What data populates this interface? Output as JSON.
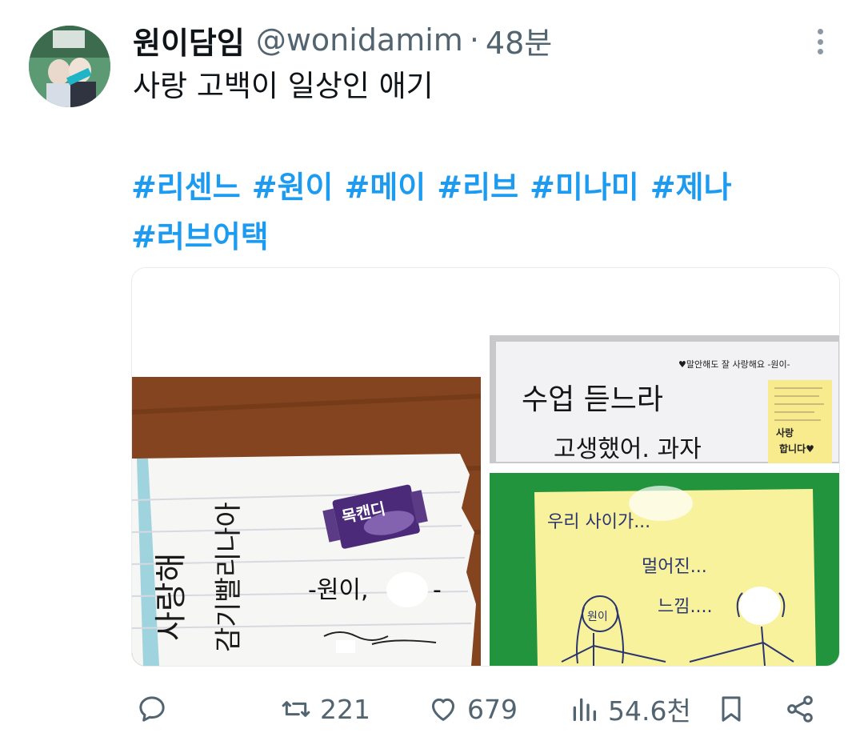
{
  "tweet": {
    "display_name": "원이담임",
    "handle": "@wonidamim",
    "separator": "·",
    "time": "48분",
    "text": "사랑 고백이 일상인 애기",
    "hashtags": [
      "#리센느",
      "#원이",
      "#메이",
      "#리브",
      "#미나미",
      "#제나",
      "#러브어택"
    ]
  },
  "media": {
    "photo1": {
      "candy_label": "목캔디",
      "note_text": "-원이,",
      "note_vertical_1": "사랑해",
      "note_vertical_2": "감기빨리나아"
    },
    "photo2": {
      "header_note": "♥말안해도 잘 사랑해요 -원이-",
      "line1": "수업 듣느라",
      "line2": "고생했어. 과자",
      "sticky_line1": "사랑",
      "sticky_line2": "합니다♥"
    },
    "photo3": {
      "line1": "우리 사이가...",
      "line2": "멀어진...",
      "line3": "느낌....",
      "figure_label": "원이"
    }
  },
  "actions": {
    "reply_count": "",
    "retweet_count": "221",
    "like_count": "679",
    "views_count": "54.6천"
  },
  "colors": {
    "hashtag": "#1d9bf0",
    "secondary_text": "#536471",
    "primary_text": "#0f1419"
  }
}
